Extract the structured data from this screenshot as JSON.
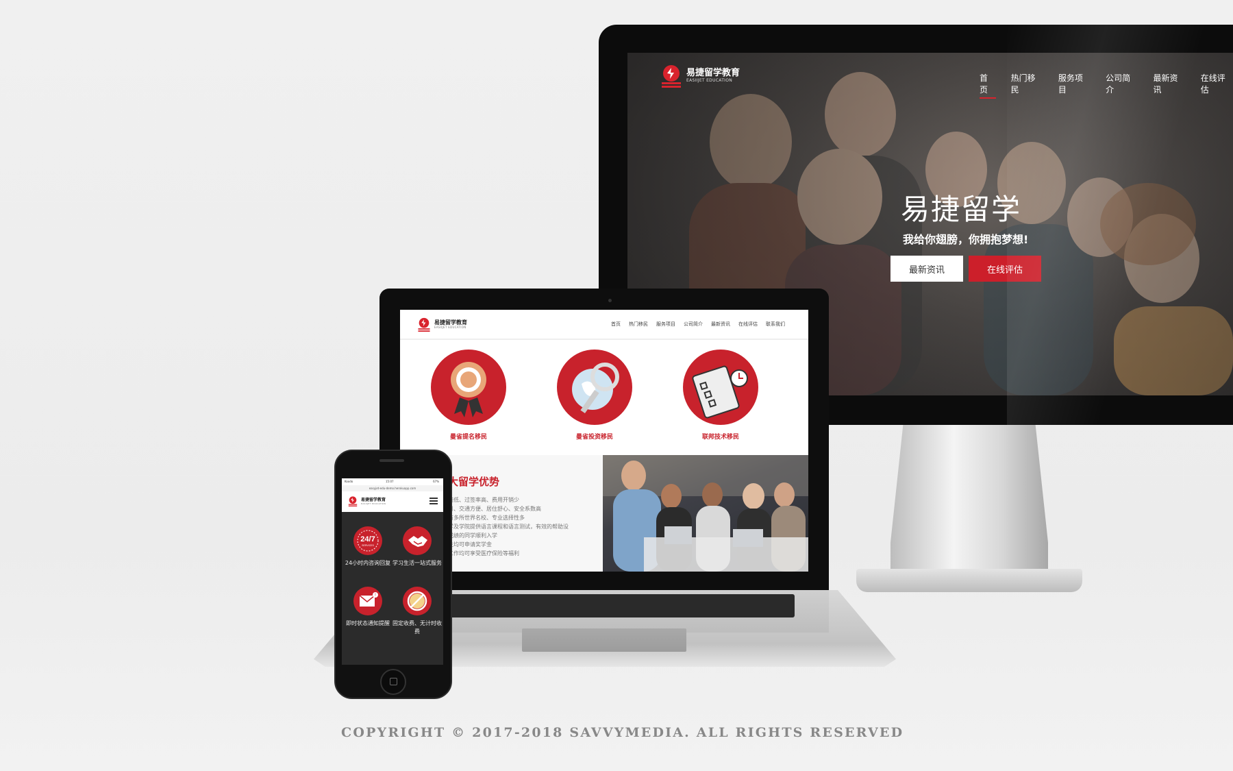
{
  "brand": {
    "name": "易捷留学教育",
    "sub": "EASIIJET EDUCATION"
  },
  "desktop": {
    "nav": [
      "首页",
      "热门移民",
      "服务项目",
      "公司简介",
      "最新资讯",
      "在线评估"
    ],
    "hero_title": "易捷留学",
    "hero_subtitle": "我给你翅膀，你拥抱梦想!",
    "btn_news": "最新资讯",
    "btn_eval": "在线评估"
  },
  "laptop": {
    "nav": [
      "首页",
      "热门移民",
      "服务项目",
      "公司简介",
      "最新资讯",
      "在线评估",
      "联系我们"
    ],
    "services": [
      "曼省提名移民",
      "曼省投资移民",
      "联邦技术移民"
    ],
    "adv_title": "大留学优势",
    "adv_lines": [
      "槛低、过签率高、费用开销少",
      "月、交通方便、居住舒心、安全系数高",
      "有多所世界名校、专业选择性多",
      "学及学院提供语言课程和语言测试，有效的帮助没",
      "成绩的同学顺利入学",
      "生均可申请奖学金",
      "工作均可享受医疗保险等福利"
    ]
  },
  "phone": {
    "carrier": "Koodo",
    "time": "15:07",
    "battery": "67%",
    "url": "easyjet-edu-demo.herokuapp.com",
    "badge": "24/7",
    "badge_sub": "SERVICES",
    "features": [
      "24小时内咨询回复",
      "学习生活一站式服务",
      "即时状态通知提醒",
      "固定收费、无计时收费"
    ]
  },
  "copyright": "COPYRIGHT © 2017-2018 SAVVYMEDIA. ALL RIGHTS RESERVED",
  "colors": {
    "accent": "#cc1f2a",
    "dark": "#0c0c0c"
  },
  "icons": [
    "award-ribbon-icon",
    "globe-magnifier-icon",
    "clipboard-checklist-icon",
    "handshake-icon",
    "envelope-alert-icon",
    "no-timer-icon",
    "hamburger-menu-icon"
  ]
}
